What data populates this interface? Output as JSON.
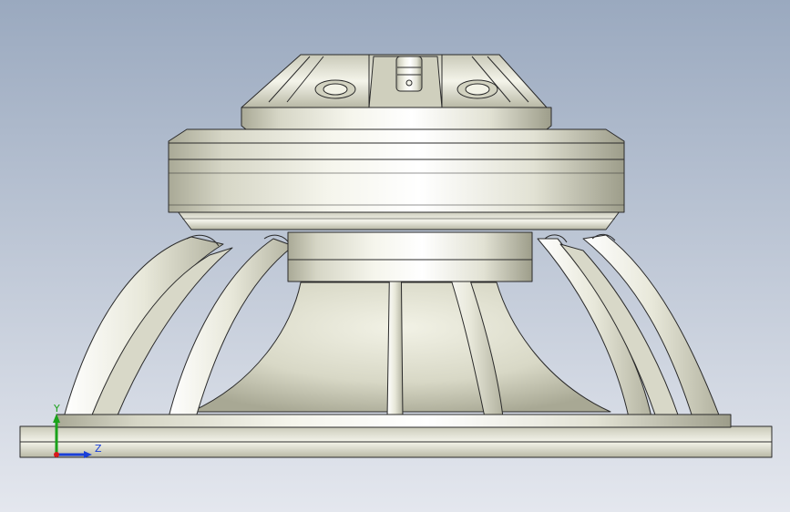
{
  "viewport": {
    "background_top": "#9aa9bf",
    "background_bottom": "#e4e7ee"
  },
  "model": {
    "part": "speaker",
    "body_color": "#e6e6d8",
    "shade_color": "#b9b9a6",
    "edge_color": "#2a2a2a"
  },
  "triad": {
    "y_label": "Y",
    "z_label": "Z",
    "y_color": "#1aa21a",
    "z_color": "#1a3fd8",
    "x_color": "#d81a1a"
  }
}
